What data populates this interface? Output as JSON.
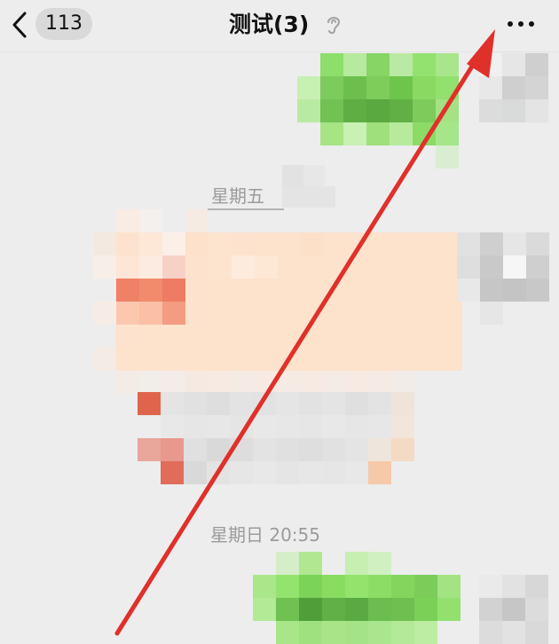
{
  "navbar": {
    "unread_count": "113",
    "title": "测试(3)",
    "back_icon": "chevron-left-icon",
    "mute_icon": "ear-muted-icon",
    "more_icon": "more-dots-icon"
  },
  "chat": {
    "timestamps": [
      "星期五",
      "星期日 20:55"
    ],
    "messages": [
      {
        "side": "right",
        "type": "text",
        "content_state": "pixelated",
        "bubble_color": "#95ec69"
      },
      {
        "side": "left",
        "type": "card",
        "content_state": "pixelated",
        "bubble_color": "#fde3cc"
      },
      {
        "side": "left",
        "type": "text",
        "content_state": "pixelated",
        "bubble_color": "#e4e4e4"
      },
      {
        "side": "right",
        "type": "text",
        "content_state": "pixelated",
        "bubble_color": "#95ec69"
      }
    ]
  },
  "annotation": {
    "type": "arrow",
    "color": "#e0302a",
    "target": "more-button"
  },
  "colors": {
    "background": "#ededed",
    "self_bubble": "#95ec69",
    "arrow": "#e0302a"
  }
}
